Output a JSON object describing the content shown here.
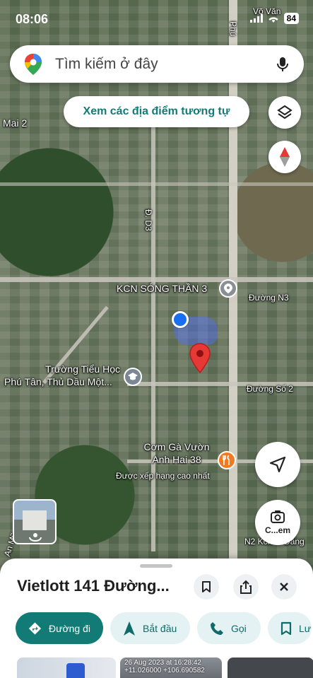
{
  "status_bar": {
    "time": "08:06",
    "battery": "84"
  },
  "search": {
    "placeholder": "Tìm kiếm ở đây"
  },
  "similar_places_label": "Xem các địa điểm tương tự",
  "map_labels": {
    "mai": "Mai 2",
    "d3": "Đ. D3",
    "kcn": "KCN SÓNG THẦN 3",
    "n3": "Đường N3",
    "school_line1": "Trường Tiểu Học",
    "school_line2": "Phú Tân, Thủ Dầu Một...",
    "so2": "Đường Số 2",
    "com_line1": "Cơm Gà Vườn",
    "com_line2": "Anh Hai 38",
    "top_rated": "Được xếp hạng cao nhất",
    "vo_van": "Võ Văn",
    "phu": "Phú",
    "n2": "N2 Kcn ... Đăng",
    "an_my": "An Mỹ - Phú"
  },
  "layers_label": "C...em",
  "place": {
    "title": "Vietlott 141 Đường..."
  },
  "actions": [
    {
      "label": "Đường đi",
      "icon": "directions-icon"
    },
    {
      "label": "Bắt đầu",
      "icon": "navigation-arrow-icon"
    },
    {
      "label": "Gọi",
      "icon": "phone-icon"
    },
    {
      "label": "Lưu",
      "icon": "bookmark-icon"
    }
  ],
  "photo_caption": {
    "line1": "26 Aug 2023 at 16:28:42",
    "line2": "+11.026000 +106.690582"
  },
  "colors": {
    "accent": "#137b76",
    "chip_bg": "#e4f2f3",
    "pin": "#e53935",
    "location_dot": "#1a6ef0"
  }
}
